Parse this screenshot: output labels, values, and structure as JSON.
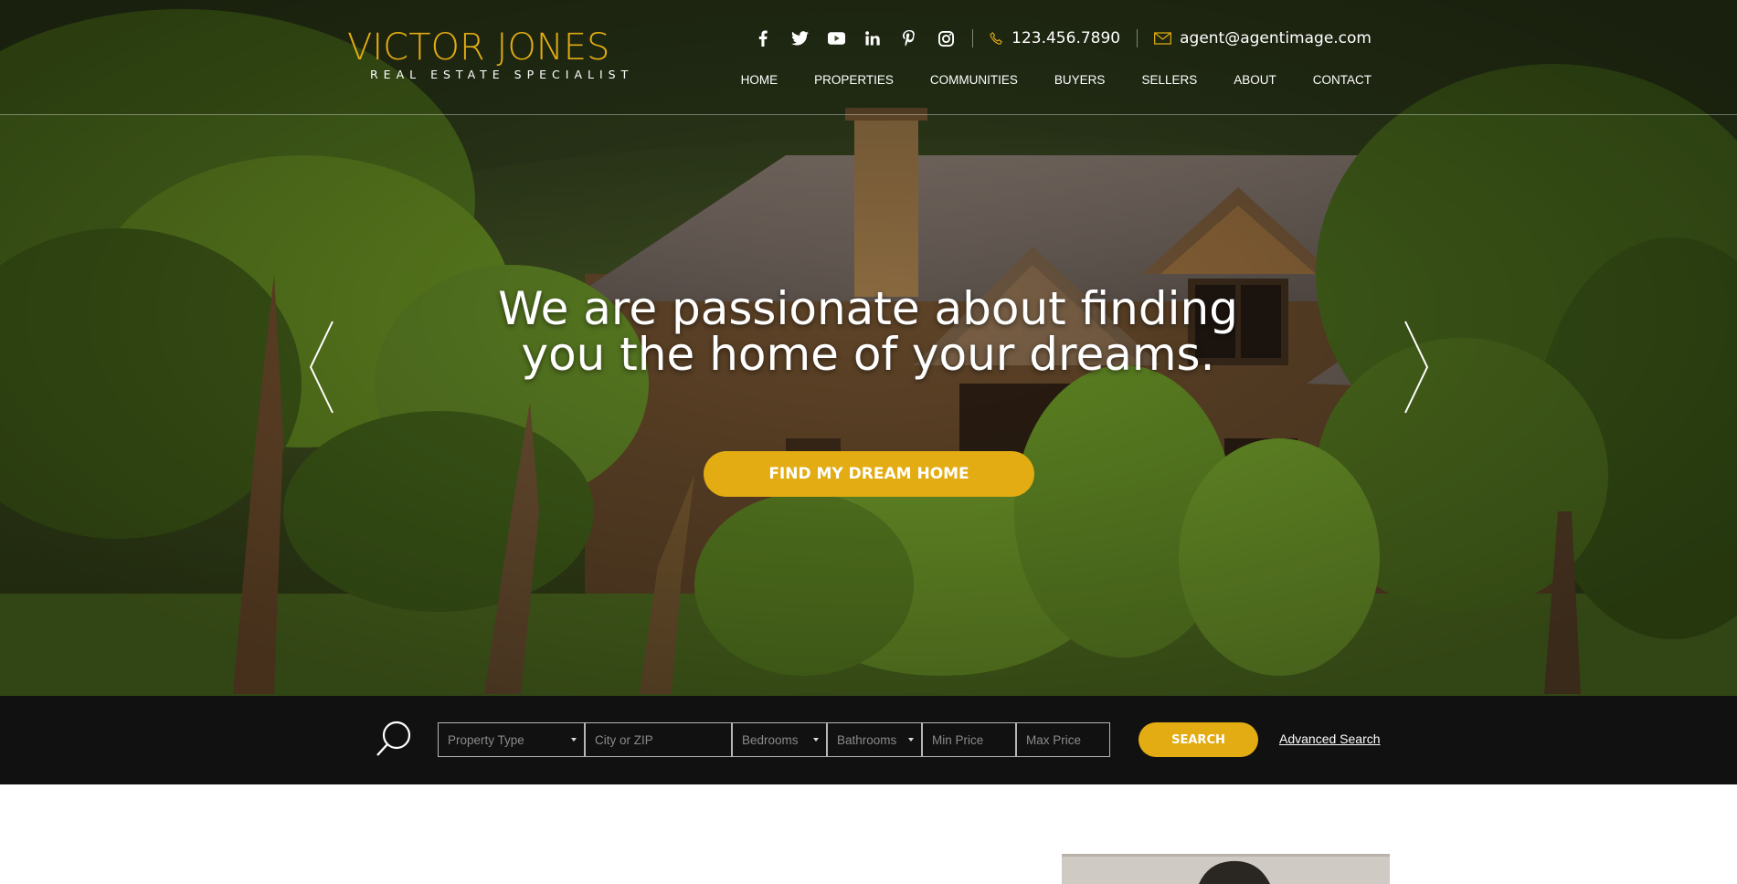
{
  "brand": {
    "name": "VICTOR JONES",
    "tagline": "REAL ESTATE SPECIALIST",
    "accent": "#e2ac12"
  },
  "social_icons": [
    "facebook-icon",
    "twitter-icon",
    "youtube-icon",
    "linkedin-icon",
    "pinterest-icon",
    "instagram-icon"
  ],
  "contact": {
    "phone": "123.456.7890",
    "email": "agent@agentimage.com"
  },
  "nav": [
    "HOME",
    "PROPERTIES",
    "COMMUNITIES",
    "BUYERS",
    "SELLERS",
    "ABOUT",
    "CONTACT"
  ],
  "hero": {
    "headline_line1": "We are passionate about finding",
    "headline_line2": "you the home of your dreams.",
    "cta_label": "FIND MY DREAM HOME"
  },
  "search": {
    "property_type": "Property Type",
    "city_zip_placeholder": "City or ZIP",
    "bedrooms": "Bedrooms",
    "bathrooms": "Bathrooms",
    "min_price_placeholder": "Min Price",
    "max_price_placeholder": "Max Price",
    "button_label": "SEARCH",
    "advanced_link": "Advanced Search"
  }
}
